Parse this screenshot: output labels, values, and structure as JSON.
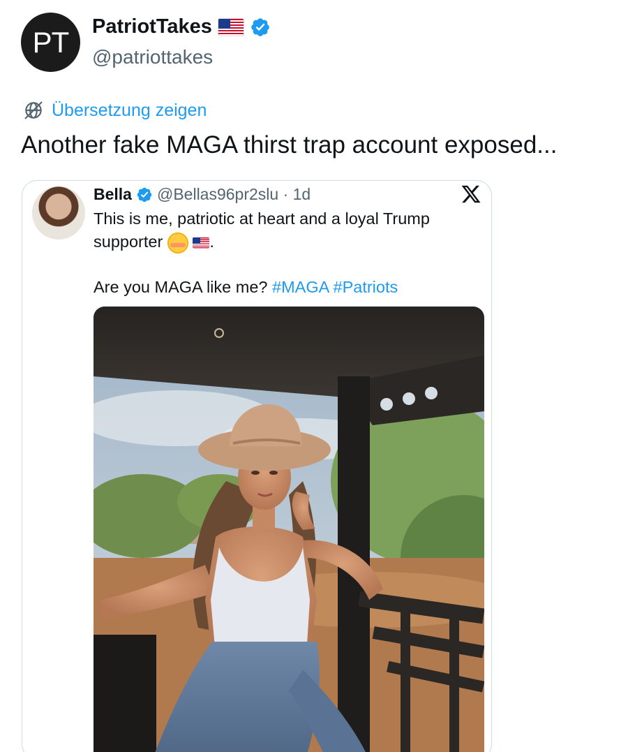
{
  "author": {
    "avatar_initials": "PT",
    "display_name": "PatriotTakes",
    "handle": "@patriottakes",
    "verified": true,
    "flag_icon": "us-flag-icon"
  },
  "translate": {
    "label": "Übersetzung zeigen",
    "icon": "globe-slash-icon"
  },
  "tweet": {
    "text": "Another fake MAGA thirst trap account exposed..."
  },
  "quote": {
    "name": "Bella",
    "handle_time": "@Bellas96pr2slu · 1d",
    "verified": true,
    "line1": "This is me, patriotic at heart and a loyal Trump",
    "line2_prefix": "supporter",
    "line2_suffix": ".",
    "line3_prefix": "Are you MAGA like me?",
    "hashtags": [
      "#MAGA",
      "#Patriots"
    ],
    "platform_icon": "x-logo-icon"
  },
  "colors": {
    "accent": "#1d9bf0",
    "text": "#0f1419",
    "secondary": "#536471",
    "border": "#cfd9de"
  }
}
